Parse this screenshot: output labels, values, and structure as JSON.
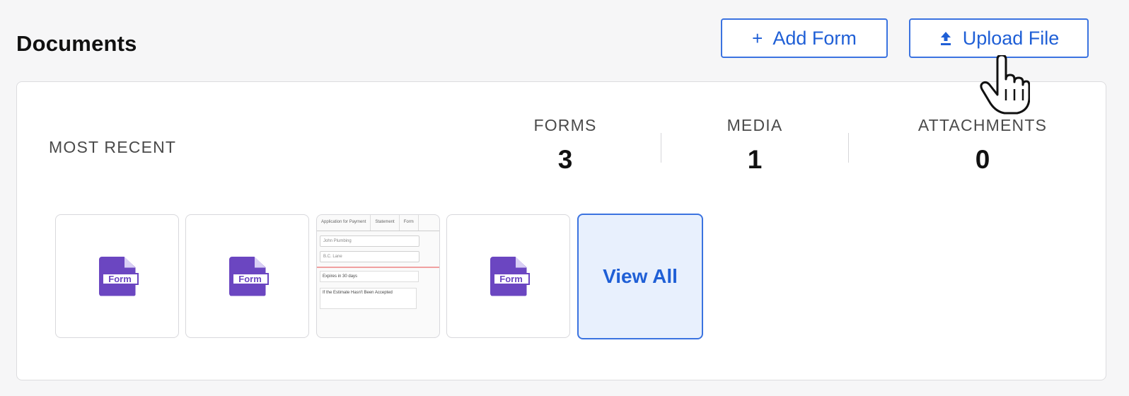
{
  "header": {
    "title": "Documents",
    "add_form_label": "Add Form",
    "add_form_icon": "plus-icon",
    "upload_file_label": "Upload File",
    "upload_file_icon": "upload-icon"
  },
  "summary": {
    "most_recent_label": "MOST RECENT",
    "stats": [
      {
        "label": "FORMS",
        "value": "3"
      },
      {
        "label": "MEDIA",
        "value": "1"
      },
      {
        "label": "ATTACHMENTS",
        "value": "0"
      }
    ]
  },
  "recent_items": [
    {
      "type": "form",
      "icon": "form-icon",
      "icon_text": "Form"
    },
    {
      "type": "form",
      "icon": "form-icon",
      "icon_text": "Form"
    },
    {
      "type": "preview",
      "tabs": [
        "Application for Payment",
        "Statement",
        "Form"
      ],
      "fields": [
        "John Plumbing",
        "B.C. Lane"
      ],
      "row1": "Expires in 30 days",
      "row2": "If the Estimate Hasn't Been Accepted"
    },
    {
      "type": "form",
      "icon": "form-icon",
      "icon_text": "Form"
    }
  ],
  "view_all_label": "View All",
  "colors": {
    "accent": "#1f5fd6",
    "form_icon": "#6b46c1",
    "view_all_bg": "#e8f0fd"
  }
}
